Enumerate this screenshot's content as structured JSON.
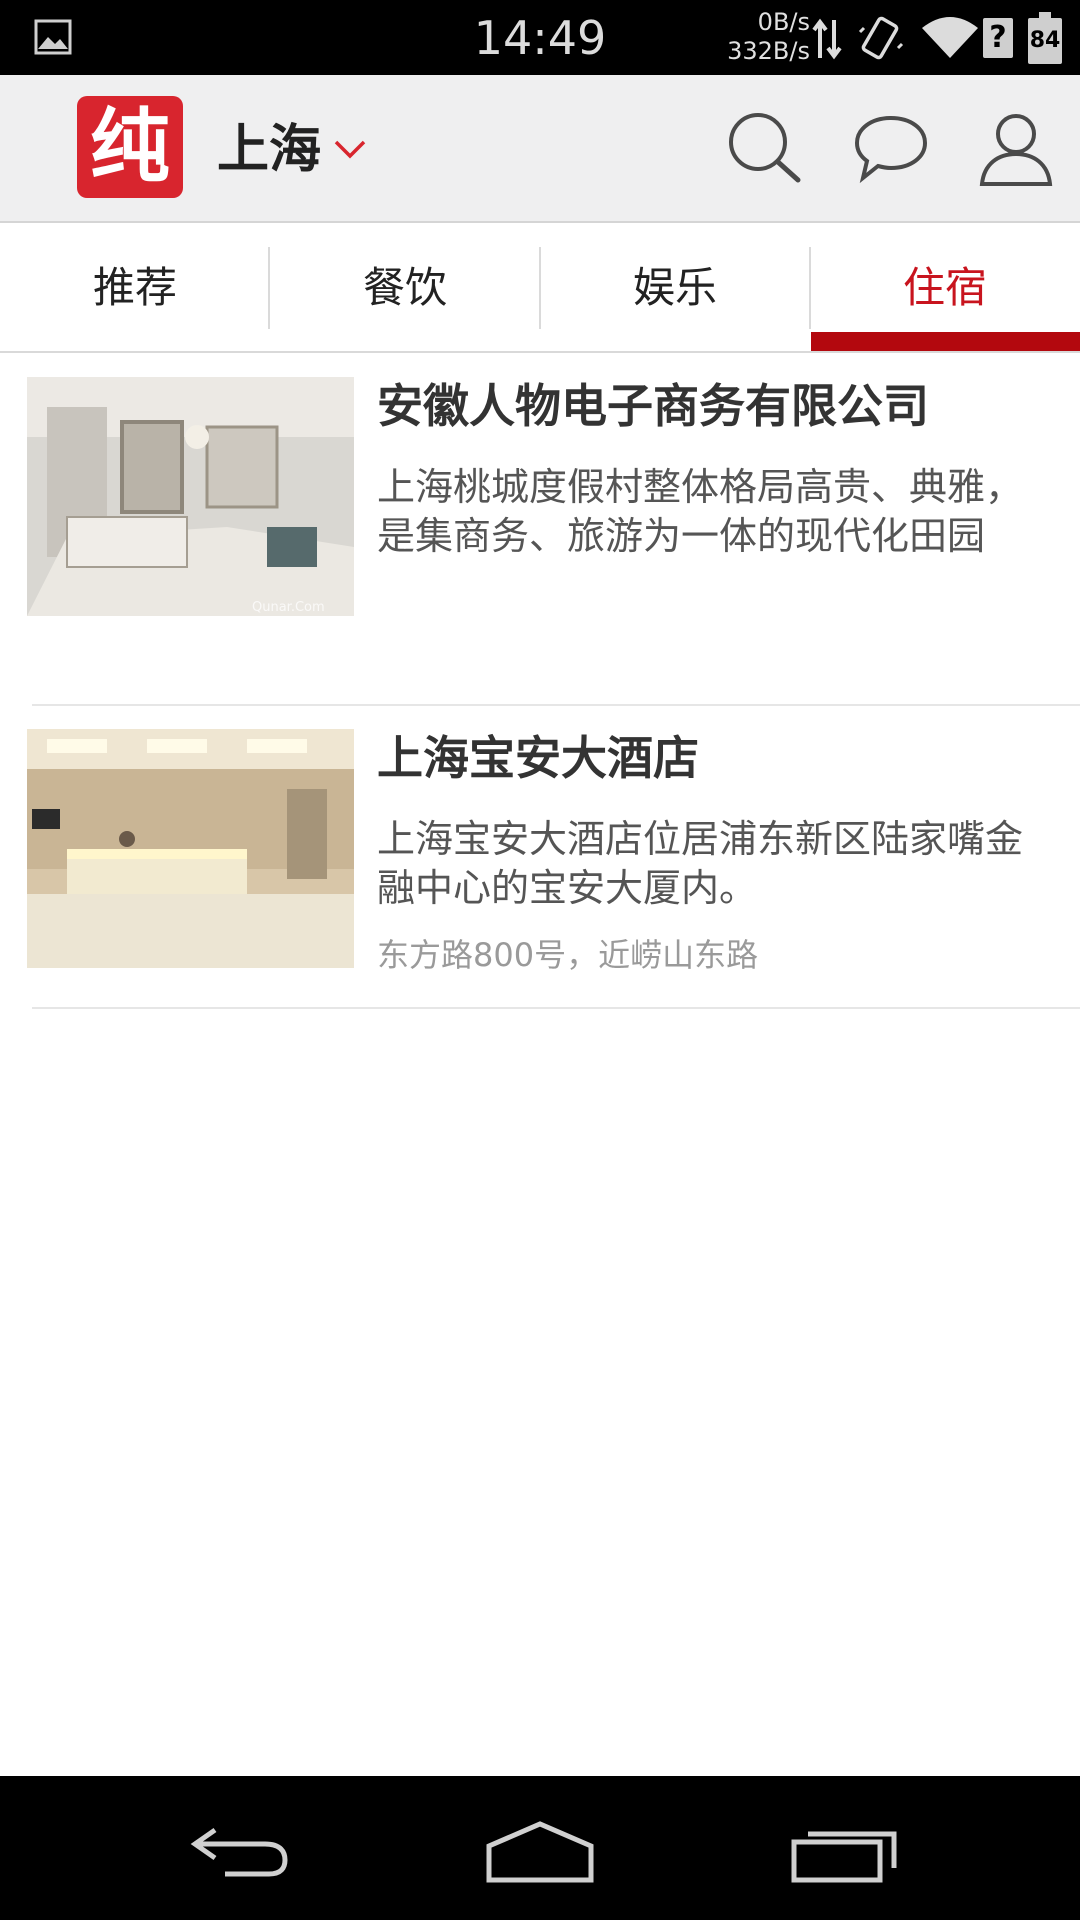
{
  "status_bar": {
    "time": "14:49",
    "net_down": "0B/s",
    "net_up": "332B/s",
    "battery_level": "84",
    "unknown_indicator": "?",
    "icons": [
      "gallery-icon",
      "data-arrows-icon",
      "vibrate-icon",
      "wifi-icon",
      "question-icon",
      "battery-icon"
    ]
  },
  "header": {
    "logo_text": "纯",
    "city": "上海",
    "icons": [
      "search-icon",
      "chat-icon",
      "user-icon"
    ],
    "accent_color": "#d8252e"
  },
  "tabs": [
    {
      "label": "推荐",
      "active": false
    },
    {
      "label": "餐饮",
      "active": false
    },
    {
      "label": "娱乐",
      "active": false
    },
    {
      "label": "住宿",
      "active": true
    }
  ],
  "listings": [
    {
      "title": "安徽人物电子商务有限公司",
      "description": "上海桃城度假村整体格局高贵、典雅，是集商务、旅游为一体的现代化田园",
      "address": "",
      "image_watermark": "Qunar.Com"
    },
    {
      "title": "上海宝安大酒店",
      "description": "上海宝安大酒店位居浦东新区陆家嘴金融中心的宝安大厦内。",
      "address": "东方路800号，近崂山东路"
    }
  ],
  "nav_bar": {
    "icons": [
      "back-icon",
      "home-icon",
      "recent-apps-icon"
    ]
  }
}
